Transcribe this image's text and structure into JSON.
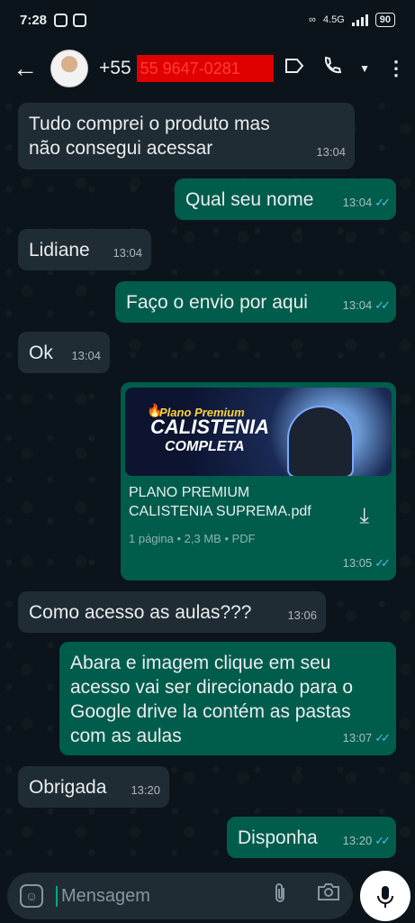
{
  "statusbar": {
    "time": "7:28",
    "network": "4.5G",
    "battery": "90"
  },
  "header": {
    "contact_prefix": "+55",
    "contact_number": "55 9647-0281"
  },
  "messages": [
    {
      "text": "Tudo comprei o produto mas não consegui acessar",
      "time": "13:04",
      "direction": "in"
    },
    {
      "text": "Qual seu nome",
      "time": "13:04",
      "direction": "out"
    },
    {
      "text": "Lidiane",
      "time": "13:04",
      "direction": "in"
    },
    {
      "text": "Faço o envio por aqui",
      "time": "13:04",
      "direction": "out"
    },
    {
      "text": "Ok",
      "time": "13:04",
      "direction": "in"
    },
    {
      "direction": "out",
      "time": "13:05",
      "thumb_line1": "Plano Premium",
      "thumb_line2": "CALISTENIA",
      "thumb_line3": "COMPLETA",
      "file_name": "PLANO PREMIUM CALISTENIA SUPREMA.pdf",
      "file_info": "1 página • 2,3 MB • PDF"
    },
    {
      "text": "Como acesso as aulas???",
      "time": "13:06",
      "direction": "in"
    },
    {
      "text": "Abara e imagem clique em seu acesso vai ser direcionado para o Google drive la contém as pastas com as aulas",
      "time": "13:07",
      "direction": "out"
    },
    {
      "text": "Obrigada",
      "time": "13:20",
      "direction": "in"
    },
    {
      "text": "Disponha",
      "time": "13:20",
      "direction": "out"
    }
  ],
  "input": {
    "placeholder": "Mensagem"
  },
  "icons": {
    "back": "arrow-left-icon",
    "label": "label-icon",
    "call": "phone-icon",
    "menu": "more-vertical-icon",
    "emoji": "sticker-icon",
    "attach": "paperclip-icon",
    "camera": "camera-icon",
    "mic": "mic-icon",
    "download": "download-icon",
    "read": "double-check-icon"
  },
  "colors": {
    "incoming": "#202c33",
    "outgoing": "#005c4b",
    "read_ticks": "#53bdeb",
    "background": "#0b141a"
  }
}
